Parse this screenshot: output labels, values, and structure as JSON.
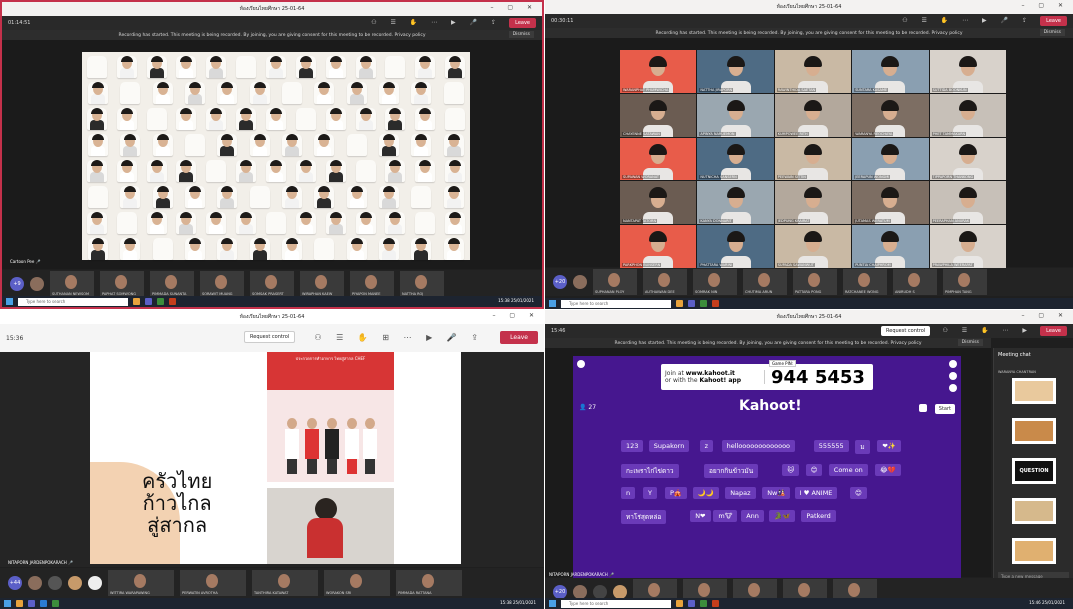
{
  "q1": {
    "title": "ห้องเรียนไทยศึกษา 25-01-64",
    "time": "01:14:51",
    "leave": "Leave",
    "recording": "Recording has started. This meeting is being recorded. By joining, you are giving consent for this meeting to be recorded. Privacy policy",
    "dismiss": "Dismiss",
    "presenter": "Cartoon Pee 🎤",
    "strip": [
      "SUTHANAN NEWSOM",
      "PAPHAT SOMWONG",
      "PIMMADA SUNANTA",
      "SORAWIT MUANG",
      "SOMSAK PRASERT",
      "WIRAPHAN KAEW",
      "PIYAPON MANEE",
      "NATTHA ROJ"
    ],
    "more": "+9",
    "search": "Type here to search",
    "clock": "15:38 25/01/2021"
  },
  "q2": {
    "title": "ห้องเรียนไทยศึกษา 25-01-64",
    "time": "00:30:11",
    "leave": "Leave",
    "recording": "Recording has started. This meeting is being recorded. By joining, you are giving consent for this meeting to be recorded. Privacy policy",
    "dismiss": "Dismiss",
    "names": [
      "WARANPHAT PHUMWICHA",
      "NATTHA JIRAPORN",
      "RAWINTHIDA SAETAN",
      "SUNTARA KASAME",
      "SUTTIDA BOONKUN",
      "CHAYENNE SATAWAN",
      "APINYA NARUEMON",
      "KUMPOWEE RITH",
      "WARANYA REOCHAYA",
      "PHET TAMMAKARN",
      "SUPAWAN WORANAT",
      "NUTNICHA SANSERN",
      "PEEWAIN SITTIN",
      "JEERAPUN WONGMI",
      "TIPPAPORN THANKONG",
      "NANTAPAT TATORN",
      "KANYA DONNARIT",
      "JEDPUNG KRAIRAT",
      "JUTAMAS WERATUM",
      "PEERAPHAN ANURAK",
      "PARKPHON BUNSERN",
      "PHATTARA WARINI",
      "SUPADA SAWANWUT",
      "PUNTIA CHAIPHROM",
      "PRAWPHILA WEERAPAT"
    ],
    "strip": [
      "SUPHANAN PLOY",
      "AUTHAIWAN DEE",
      "SOMRAK NIN",
      "CHUTIMA ARUN",
      "PATTARA PONG",
      "RATCHANEE WONG",
      "ANIRUDH S",
      "PIMPHAN TANG"
    ],
    "more": "+20",
    "search": "Type here to search"
  },
  "q3": {
    "title": "ห้องเรียนไทยศึกษา 25-01-64",
    "time": "15:36",
    "request_control": "Request control",
    "leave": "Leave",
    "slide_title_1": "ครัวไทย",
    "slide_title_2": "ก้าวไกล",
    "slide_title_3": "สู่สากล",
    "banner_text": "ประกวดการทำอาหาร ไทยสู่สากล CHEF",
    "presenter": "NITAPORN JARDENPOKARACH 🎤",
    "strip": [
      "WITTIRA WARAPAWING",
      "PERWATIN AVROTHA",
      "TANTHIRA KATAWAT",
      "WORAKON SRI",
      "PIMMADA RATTANA"
    ],
    "more": "+44",
    "clock": "15:38 25/01/2021"
  },
  "q4": {
    "title": "ห้องเรียนไทยศึกษา 25-01-64",
    "time": "15:46",
    "request_control": "Request control",
    "leave": "Leave",
    "recording": "Recording has started. This meeting is being recorded. By joining, you are giving consent for this meeting to be recorded. Privacy policy",
    "dismiss": "Dismiss",
    "join_line1": "Join at ",
    "join_site": "www.kahoot.it",
    "join_line2": "or with the ",
    "join_app": "Kahoot! app",
    "game_pin_label": "Game PIN:",
    "game_pin": "944 5453",
    "logo": "Kahoot!",
    "players": "27",
    "start": "Start",
    "nicknames": [
      [
        "123",
        "Supakorn",
        "z",
        "hellooooooooooooo",
        "555555",
        "ม",
        "❤✨"
      ],
      [
        "กะเพราไก่ไข่ดาว",
        "อยากกินข้าวมัน",
        "🐱",
        "😊",
        "Come on",
        "😂💔"
      ],
      [
        "n",
        "Y",
        "P🎪",
        "🌙🌙",
        "Napaz",
        "Nw🎎",
        "I ♥ ANIME",
        "😊"
      ],
      [
        "ทาโร่สุดหล่อ",
        "N❤",
        "m🐮",
        "Ann",
        "🐊🦋",
        "Patkerd"
      ]
    ],
    "chat_header": "Meeting chat",
    "chat_sender": "WARANYA CHANTRAN",
    "chat_question": "QUESTION",
    "compose": "Type a new message",
    "presenter": "NITAPORN JARDENPOKARACH 🎤",
    "more": "+20",
    "search": "Type here to search",
    "clock": "15:46 25/01/2021"
  }
}
